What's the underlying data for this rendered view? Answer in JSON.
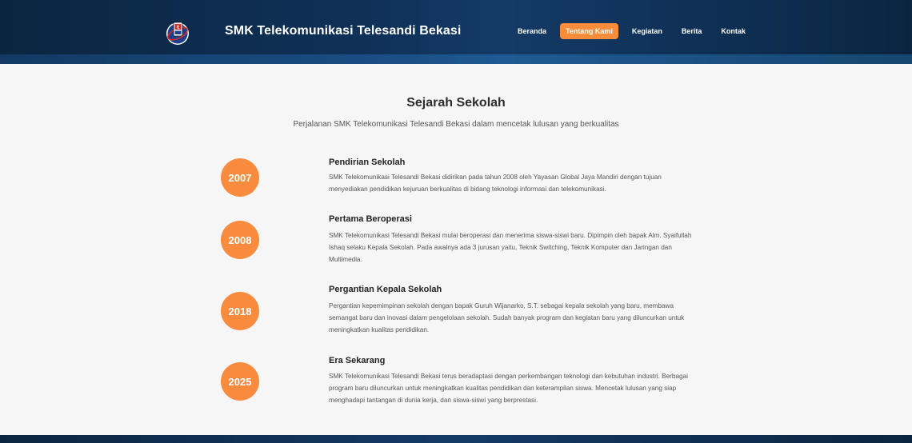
{
  "header": {
    "brand": "SMK Telekomunikasi Telesandi Bekasi",
    "nav": [
      {
        "label": "Beranda"
      },
      {
        "label": "Tentang Kami"
      },
      {
        "label": "Kegiatan"
      },
      {
        "label": "Berita"
      },
      {
        "label": "Kontak"
      }
    ],
    "active_nav": "Tentang Kami",
    "accent_color": "#f78c3a"
  },
  "section": {
    "title": "Sejarah Sekolah",
    "subtitle": "Perjalanan SMK Telekomunikasi Telesandi Bekasi dalam mencetak lulusan yang berkualitas"
  },
  "timeline": [
    {
      "year": "2007",
      "title": "Pendirian Sekolah",
      "desc_lines": [
        "SMK Telekomunikasi Telesandi Bekasi didirikan pada tahun 2008 oleh Yayasan Global Jaya Mandiri dengan tujuan",
        "menyediakan pendidikan kejuruan berkualitas di bidang teknologi informasi dan telekomunikasi."
      ]
    },
    {
      "year": "2008",
      "title": "Pertama Beroperasi",
      "desc_lines": [
        "SMK Telekomunikasi Telesandi Bekasi mulai beroperasi dan menerima siswa-siswi baru. Dipimpin oleh bapak Alm. Syaifullah",
        "Ishaq selaku Kepala Sekolah. Pada awalnya ada 3 jurusan yaitu, Teknik Switching, Teknik Komputer dan Jaringan dan",
        "Multimedia."
      ]
    },
    {
      "year": "2018",
      "title": "Pergantian Kepala Sekolah",
      "desc_lines": [
        "Pergantian kepemimpinan sekolah dengan bapak Guruh Wijanarko, S.T. sebagai kepala sekolah yang baru, membawa",
        "semangat baru dan inovasi dalam pengelolaan sekolah. Sudah banyak program dan kegiatan baru yang diluncurkan untuk",
        "meningkatkan kualitas pendidikan."
      ]
    },
    {
      "year": "2025",
      "title": "Era Sekarang",
      "desc_lines": [
        "SMK Telekomunikasi Telesandi Bekasi terus beradaptasi dengan perkembangan teknologi dan kebutuhan industri. Berbagai",
        "program baru diluncurkan untuk meningkatkan kualitas pendidikan dan keterampilan siswa. Mencetak lulusan yang siap",
        "menghadapi tantangan di dunia kerja, dan siswa-siswi yang berprestasi."
      ]
    }
  ],
  "colors": {
    "badge": "#f88b3e",
    "header_dark": "#0b2540"
  }
}
